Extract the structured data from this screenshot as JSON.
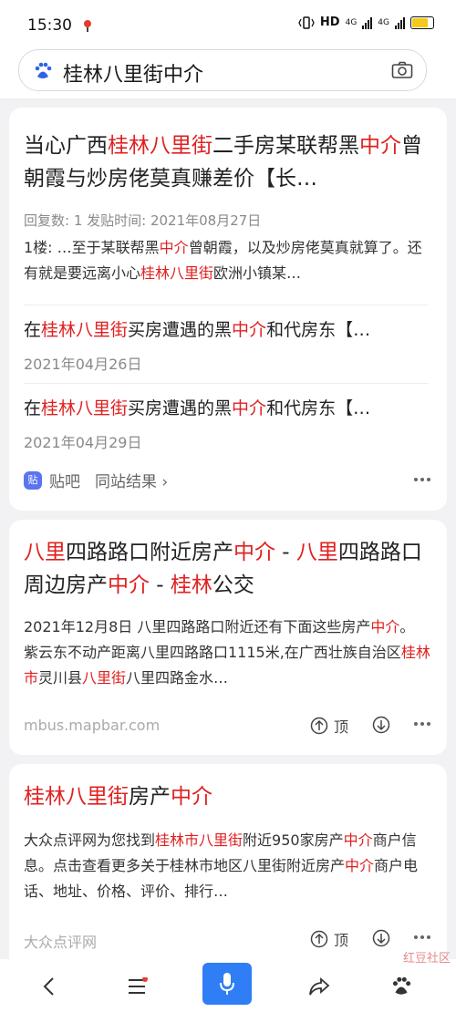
{
  "status": {
    "time": "15:30",
    "network": "HD",
    "net1": "4G",
    "net2": "4G"
  },
  "search": {
    "query": "桂林八里街中介"
  },
  "card1": {
    "title": [
      {
        "t": "当心广西",
        "h": false
      },
      {
        "t": "桂林八里街",
        "h": true
      },
      {
        "t": "二手房某联帮黑",
        "h": false
      },
      {
        "t": "中介",
        "h": true
      },
      {
        "t": "曾朝霞与炒房佬莫真赚差价【长…",
        "h": false
      }
    ],
    "meta": "回复数: 1  发贴时间: 2021年08月27日",
    "snippet": [
      {
        "t": "1楼: …至于某联帮黑",
        "h": false
      },
      {
        "t": "中介",
        "h": true
      },
      {
        "t": "曾朝霞，以及炒房佬莫真就算了。还有就是要远离小心",
        "h": false
      },
      {
        "t": "桂林八里街",
        "h": true
      },
      {
        "t": "欧洲小镇某…",
        "h": false
      }
    ],
    "sub1": {
      "title": [
        {
          "t": "在",
          "h": false
        },
        {
          "t": "桂林八里街",
          "h": true
        },
        {
          "t": "买房遭遇的黑",
          "h": false
        },
        {
          "t": "中介",
          "h": true
        },
        {
          "t": "和代房东【…",
          "h": false
        }
      ],
      "date": "2021年04月26日"
    },
    "sub2": {
      "title": [
        {
          "t": "在",
          "h": false
        },
        {
          "t": "桂林八里街",
          "h": true
        },
        {
          "t": "买房遭遇的黑",
          "h": false
        },
        {
          "t": "中介",
          "h": true
        },
        {
          "t": "和代房东【…",
          "h": false
        }
      ],
      "date": "2021年04月29日"
    },
    "source": "贴吧",
    "same_site": "同站结果 ›",
    "icon_glyph": "贴"
  },
  "card2": {
    "title": [
      {
        "t": "八里",
        "h": true
      },
      {
        "t": "四路路口附近房产",
        "h": false
      },
      {
        "t": "中介",
        "h": true
      },
      {
        "t": " - ",
        "h": false
      },
      {
        "t": "八里",
        "h": true
      },
      {
        "t": "四路路口周边房产",
        "h": false
      },
      {
        "t": "中介",
        "h": true
      },
      {
        "t": " - ",
        "h": false
      },
      {
        "t": "桂林",
        "h": true
      },
      {
        "t": "公交",
        "h": false
      }
    ],
    "snippet": [
      {
        "t": "2021年12月8日  八里四路路口附近还有下面这些房产",
        "h": false
      },
      {
        "t": "中介",
        "h": true
      },
      {
        "t": "。 紫云东不动产距离八里四路路口1115米,在广西壮族自治区",
        "h": false
      },
      {
        "t": "桂林市",
        "h": true
      },
      {
        "t": "灵川县",
        "h": false
      },
      {
        "t": "八里街",
        "h": true
      },
      {
        "t": "八里四路金水…",
        "h": false
      }
    ],
    "source": "mbus.mapbar.com",
    "up_label": "顶"
  },
  "card3": {
    "title": [
      {
        "t": "桂林八里街",
        "h": true
      },
      {
        "t": "房产",
        "h": false
      },
      {
        "t": "中介",
        "h": true
      }
    ],
    "snippet": [
      {
        "t": "大众点评网为您找到",
        "h": false
      },
      {
        "t": "桂林市八里街",
        "h": true
      },
      {
        "t": "附近950家房产",
        "h": false
      },
      {
        "t": "中介",
        "h": true
      },
      {
        "t": "商户信息。点击查看更多关于桂林市地区八里街附近房产",
        "h": false
      },
      {
        "t": "中介",
        "h": true
      },
      {
        "t": "商户电话、地址、价格、评价、排行…",
        "h": false
      }
    ],
    "source": "大众点评网",
    "up_label": "顶"
  },
  "watermark": "红豆社区"
}
